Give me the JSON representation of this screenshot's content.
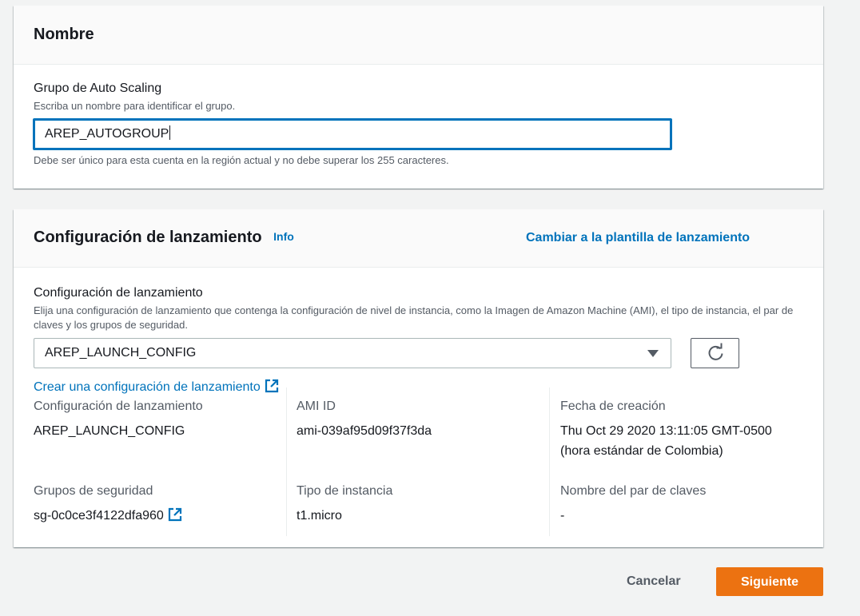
{
  "name_section": {
    "title": "Nombre",
    "field_label": "Grupo de Auto Scaling",
    "field_description": "Escriba un nombre para identificar el grupo.",
    "field_value": "AREP_AUTOGROUP",
    "field_constraint": "Debe ser único para esta cuenta en la región actual y no debe superar los 255 caracteres."
  },
  "launch_section": {
    "title": "Configuración de lanzamiento",
    "info_link": "Info",
    "switch_link": "Cambiar a la plantilla de lanzamiento",
    "field_label": "Configuración de lanzamiento",
    "field_description": "Elija una configuración de lanzamiento que contenga la configuración de nivel de instancia, como la Imagen de Amazon Machine (AMI), el tipo de instancia, el par de claves y los grupos de seguridad.",
    "selected_value": "AREP_LAUNCH_CONFIG",
    "refresh_icon": "refresh-icon",
    "create_link": "Crear una configuración de lanzamiento",
    "details": {
      "launch_config_key": "Configuración de lanzamiento",
      "launch_config_value": "AREP_LAUNCH_CONFIG",
      "ami_key": "AMI ID",
      "ami_value": "ami-039af95d09f37f3da",
      "created_key": "Fecha de creación",
      "created_value_line1": "Thu Oct 29 2020 13:11:05 GMT-0500",
      "created_value_line2": "(hora estándar de Colombia)",
      "security_groups_key": "Grupos de seguridad",
      "security_groups_value": "sg-0c0ce3f4122dfa960",
      "instance_type_key": "Tipo de instancia",
      "instance_type_value": "t1.micro",
      "key_pair_key": "Nombre del par de claves",
      "key_pair_value": "-"
    }
  },
  "footer": {
    "cancel_label": "Cancelar",
    "next_label": "Siguiente"
  },
  "colors": {
    "link": "#0073bb",
    "primary_button": "#ec7211",
    "background": "#f2f3f3"
  }
}
